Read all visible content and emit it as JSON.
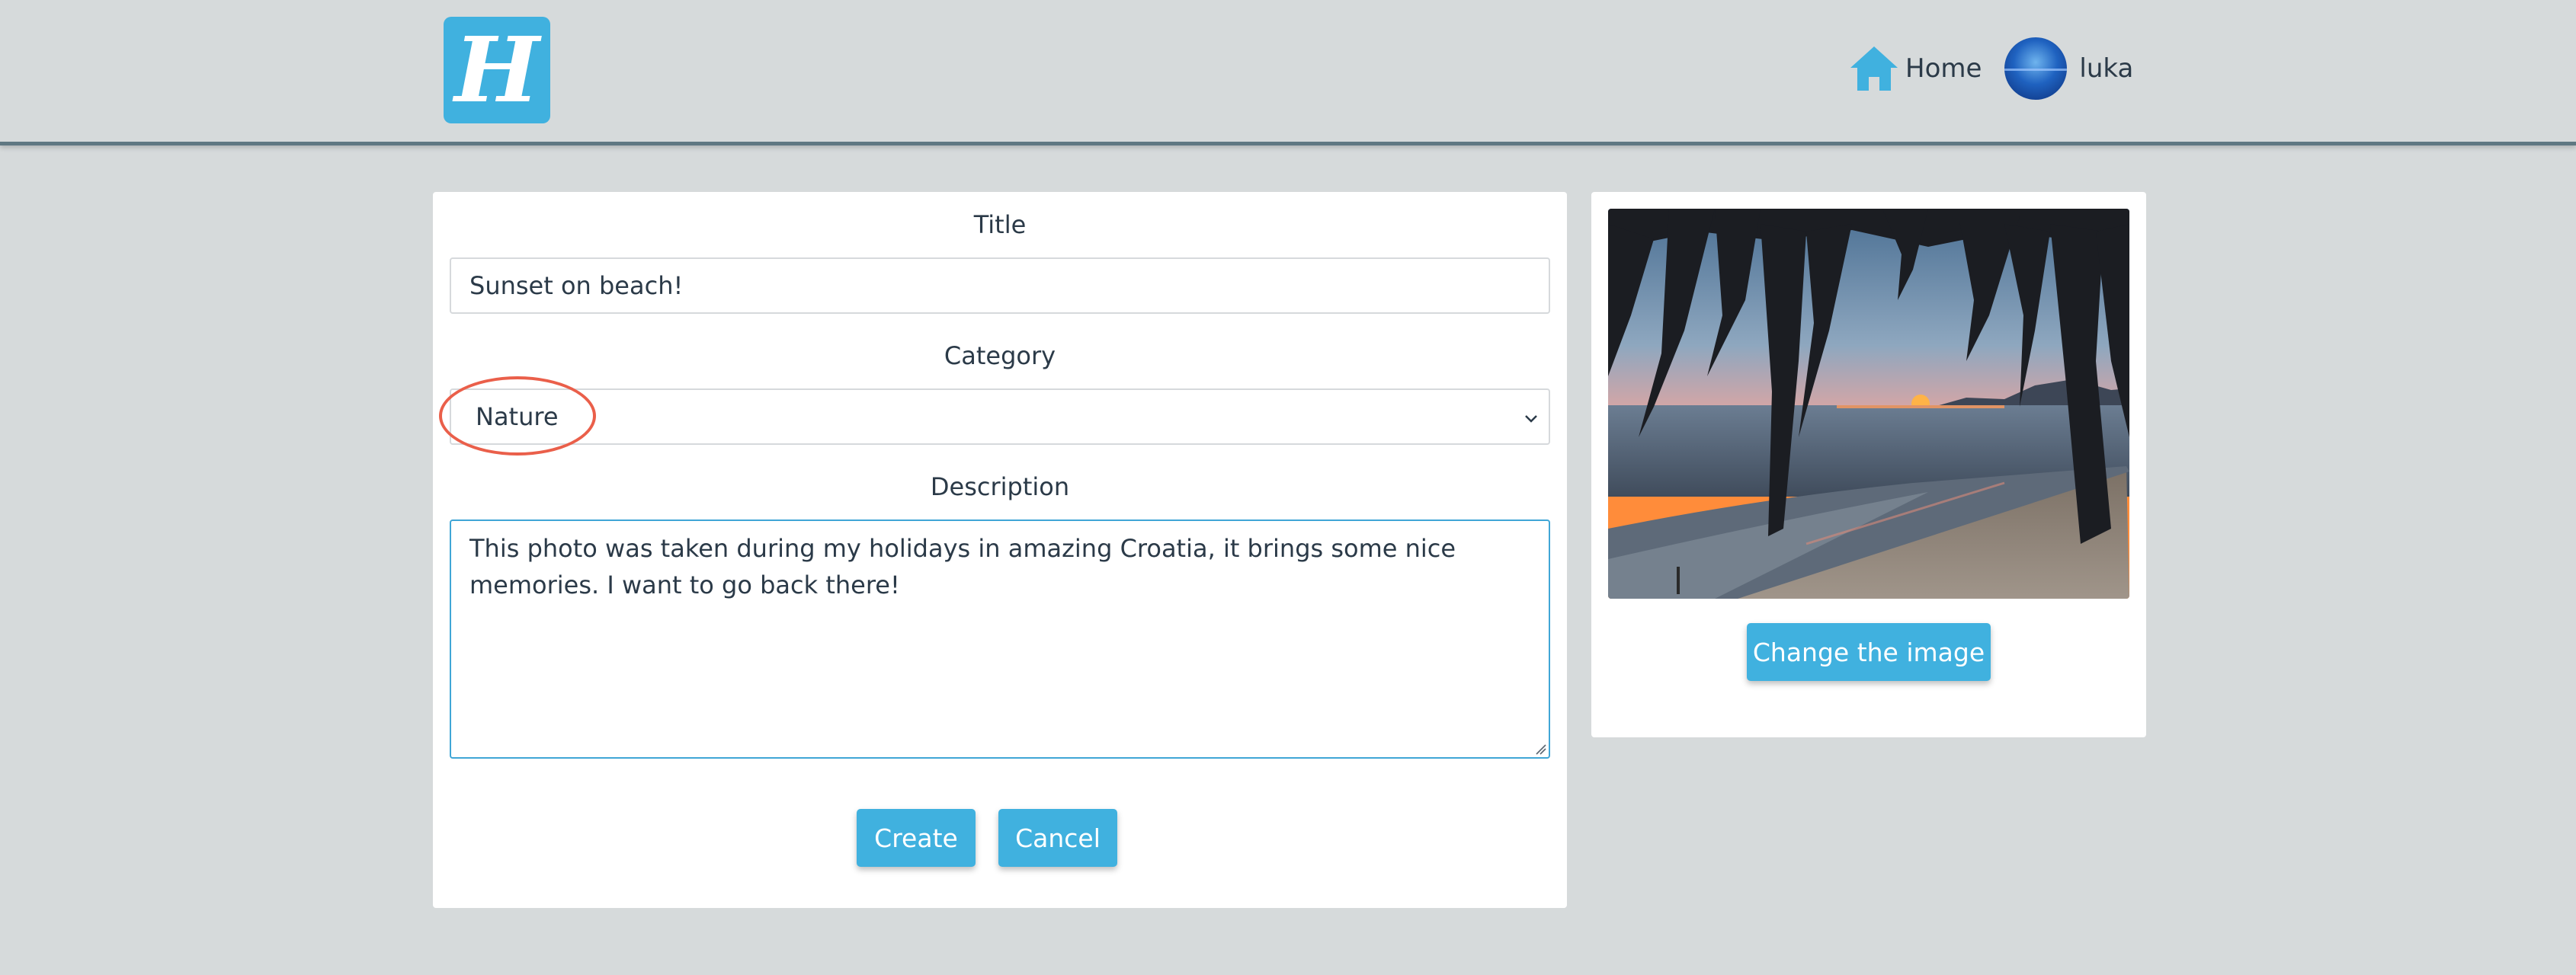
{
  "header": {
    "logo_letter": "H",
    "nav": {
      "home_label": "Home",
      "user_label": "luka",
      "home_icon": "home-icon",
      "avatar_icon": "user-avatar"
    }
  },
  "form": {
    "title_label": "Title",
    "title_value": "Sunset on beach!",
    "category_label": "Category",
    "category_value": "Nature",
    "description_label": "Description",
    "description_value": "This photo was taken during my holidays in amazing Croatia, it brings some nice memories. I want to go back there!",
    "create_button": "Create",
    "cancel_button": "Cancel"
  },
  "image_panel": {
    "change_button": "Change the image"
  },
  "colors": {
    "accent": "#40b1df",
    "background": "#d6dadb",
    "highlight": "#ea5f4a"
  }
}
